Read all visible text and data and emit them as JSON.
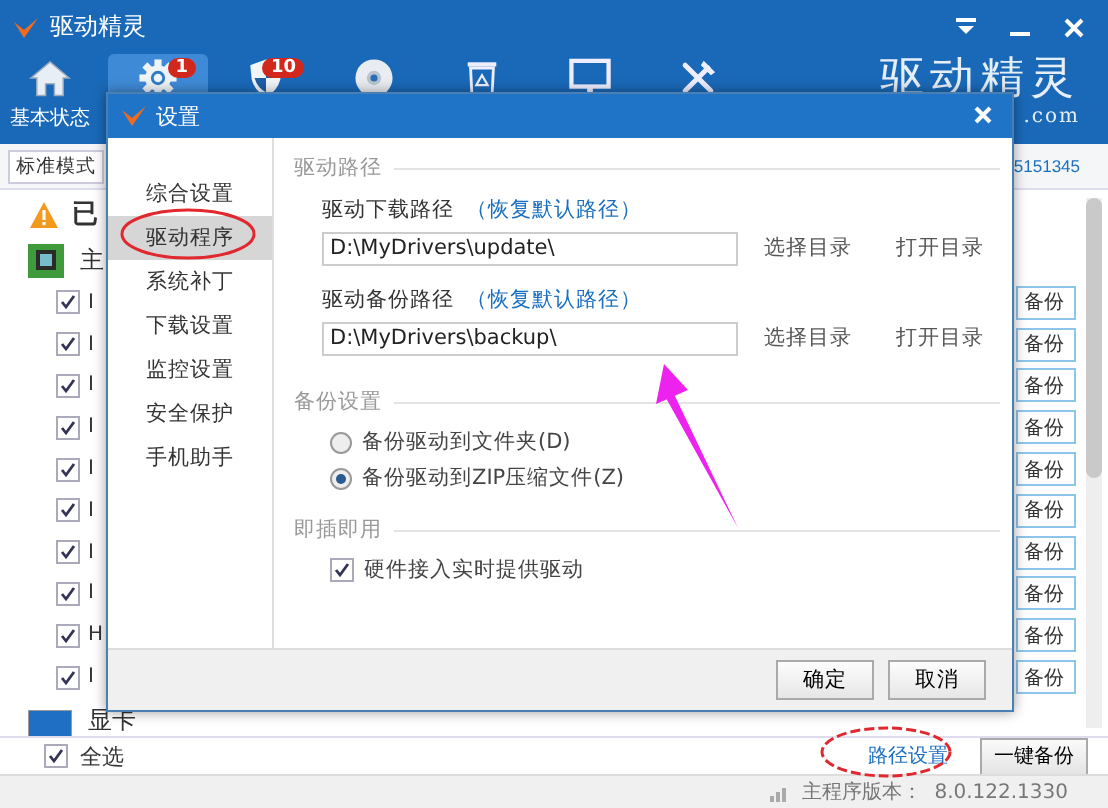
{
  "window": {
    "title": "驱动精灵"
  },
  "toolbar": [
    {
      "kind": "home",
      "label": "基本状态",
      "selected": false
    },
    {
      "kind": "gear",
      "badge": "1",
      "selected": true
    },
    {
      "kind": "shield",
      "badge": "10",
      "selected": false
    },
    {
      "kind": "disc",
      "selected": false
    },
    {
      "kind": "recycle",
      "selected": false
    },
    {
      "kind": "monitor",
      "selected": false
    },
    {
      "kind": "tools",
      "selected": false
    }
  ],
  "logo": {
    "text": "驱动精灵",
    "suffix": ".com"
  },
  "mode_bar": {
    "mode": "标准模式",
    "link": "5151345"
  },
  "notice": {
    "text": "已"
  },
  "list": {
    "group": "主",
    "rows": [
      {
        "label": "I",
        "checked": true,
        "button": "备份"
      },
      {
        "label": "I",
        "checked": true,
        "button": "备份"
      },
      {
        "label": "I",
        "checked": true,
        "button": "备份"
      },
      {
        "label": "I",
        "checked": true,
        "button": "备份"
      },
      {
        "label": "I",
        "checked": true,
        "button": "备份"
      },
      {
        "label": "I",
        "checked": true,
        "button": "备份"
      },
      {
        "label": "I",
        "checked": true,
        "button": "备份"
      },
      {
        "label": "I",
        "checked": true,
        "button": "备份"
      },
      {
        "label": "H",
        "checked": true,
        "button": "备份"
      },
      {
        "label": "I",
        "checked": true,
        "button": "备份"
      }
    ],
    "group_2": "显卡"
  },
  "footer": {
    "select_all": {
      "label": "全选",
      "checked": true
    },
    "path_link": "路径设置",
    "backup_all": "一键备份"
  },
  "status_bar": {
    "label": "主程序版本：",
    "version": "8.0.122.1330"
  },
  "dialog": {
    "title": "设置",
    "nav": [
      {
        "label": "综合设置",
        "selected": false
      },
      {
        "label": "驱动程序",
        "selected": true
      },
      {
        "label": "系统补丁",
        "selected": false
      },
      {
        "label": "下载设置",
        "selected": false
      },
      {
        "label": "监控设置",
        "selected": false
      },
      {
        "label": "安全保护",
        "selected": false
      },
      {
        "label": "手机助手",
        "selected": false
      }
    ],
    "sections": [
      {
        "kind": "paths",
        "title": "驱动路径",
        "paths": [
          {
            "label": "驱动下载路径",
            "reset_link": "（恢复默认路径）",
            "value": "D:\\MyDrivers\\update\\",
            "browse": "选择目录",
            "open": "打开目录"
          },
          {
            "label": "驱动备份路径",
            "reset_link": "（恢复默认路径）",
            "value": "D:\\MyDrivers\\backup\\",
            "browse": "选择目录",
            "open": "打开目录"
          }
        ]
      },
      {
        "kind": "radios",
        "title": "备份设置",
        "options": [
          {
            "label": "备份驱动到文件夹(D)",
            "selected": false
          },
          {
            "label": "备份驱动到ZIP压缩文件(Z)",
            "selected": true
          }
        ]
      },
      {
        "kind": "checks",
        "title": "即插即用",
        "options": [
          {
            "label": "硬件接入实时提供驱动",
            "checked": true
          }
        ]
      }
    ],
    "buttons": [
      "确定",
      "取消"
    ]
  }
}
